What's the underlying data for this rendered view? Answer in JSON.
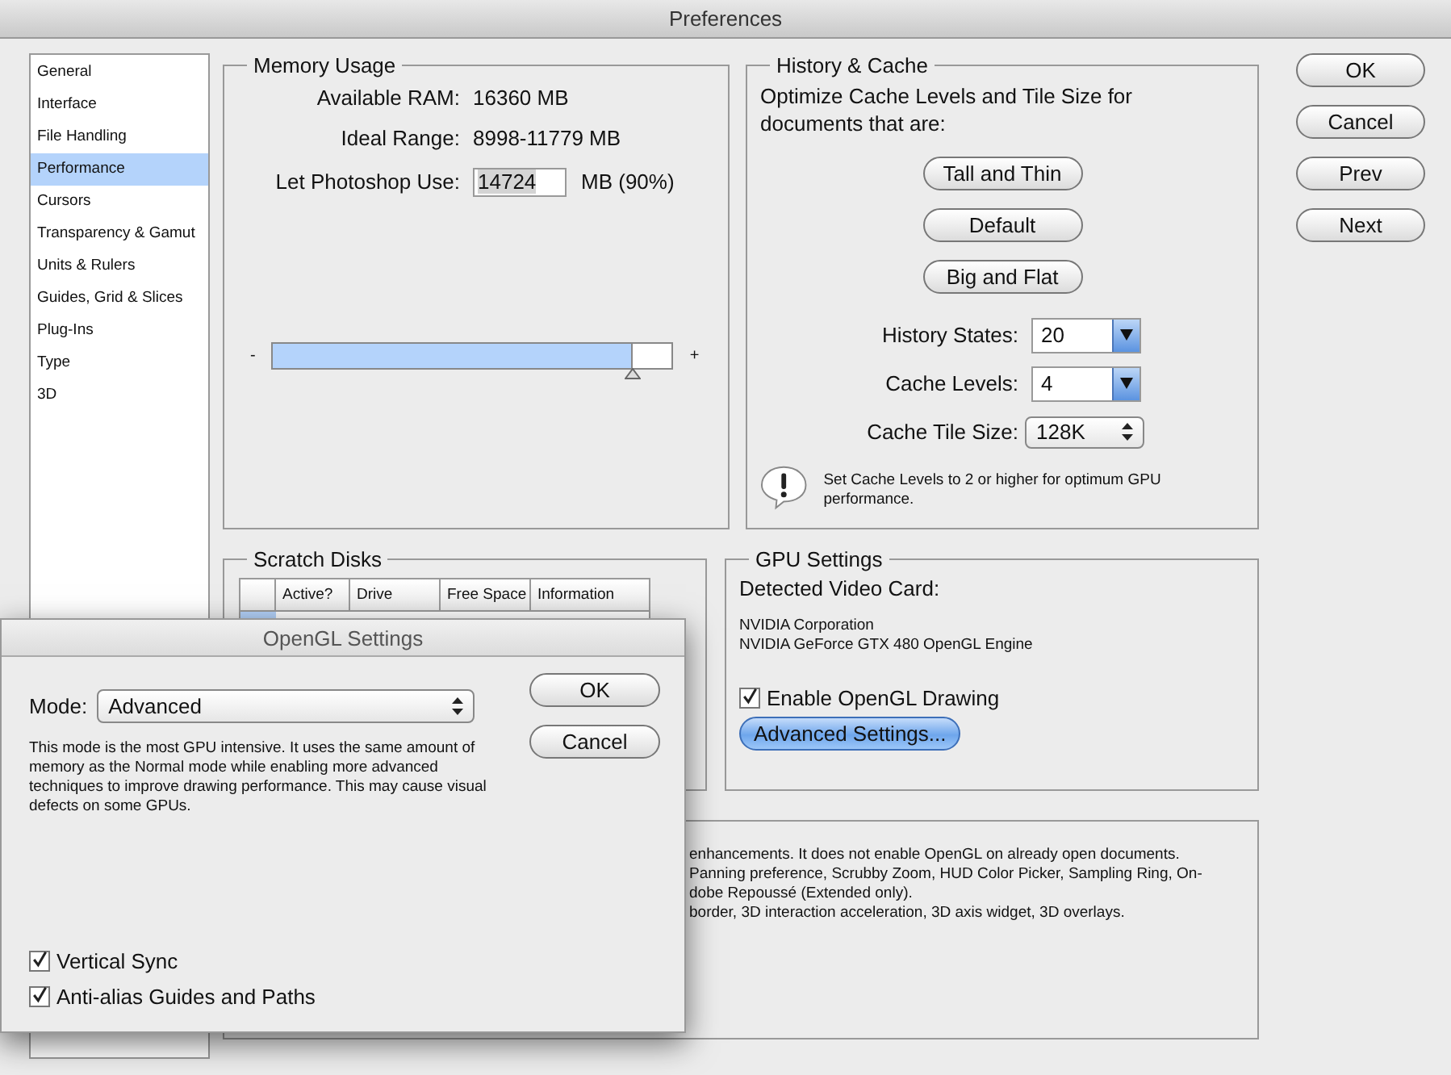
{
  "window": {
    "title": "Preferences"
  },
  "sidebar": {
    "items": [
      {
        "label": "General",
        "selected": false
      },
      {
        "label": "Interface",
        "selected": false
      },
      {
        "label": "File Handling",
        "selected": false
      },
      {
        "label": "Performance",
        "selected": true
      },
      {
        "label": "Cursors",
        "selected": false
      },
      {
        "label": "Transparency & Gamut",
        "selected": false
      },
      {
        "label": "Units & Rulers",
        "selected": false
      },
      {
        "label": "Guides, Grid & Slices",
        "selected": false
      },
      {
        "label": "Plug-Ins",
        "selected": false
      },
      {
        "label": "Type",
        "selected": false
      },
      {
        "label": "3D",
        "selected": false
      }
    ]
  },
  "memory_usage": {
    "title": "Memory Usage",
    "rows": [
      {
        "label": "Available RAM:",
        "value": "16360 MB"
      },
      {
        "label": "Ideal Range:",
        "value": "8998-11779 MB"
      }
    ],
    "use_label": "Let Photoshop Use:",
    "use_value": "14724",
    "use_unit": "MB (90%)",
    "slider": {
      "minus": "-",
      "plus": "+",
      "level": 0.9
    }
  },
  "history_cache": {
    "title": "History & Cache",
    "intro": "Optimize Cache Levels and Tile Size for documents that are:",
    "presets": [
      "Tall and Thin",
      "Default",
      "Big and Flat"
    ],
    "fields": [
      {
        "label": "History States:",
        "value": "20",
        "kind": "combo"
      },
      {
        "label": "Cache Levels:",
        "value": "4",
        "kind": "combo"
      },
      {
        "label": "Cache Tile Size:",
        "value": "128K",
        "kind": "popup"
      }
    ],
    "notice": "Set Cache Levels to 2 or higher for optimum GPU performance."
  },
  "buttons": [
    "OK",
    "Cancel",
    "Prev",
    "Next"
  ],
  "scratch_disks": {
    "title": "Scratch Disks",
    "columns": [
      "Active?",
      "Drive",
      "Free Space",
      "Information"
    ]
  },
  "gpu_settings": {
    "title": "GPU Settings",
    "detected_label": "Detected Video Card:",
    "card_lines": [
      "NVIDIA Corporation",
      "NVIDIA GeForce GTX 480 OpenGL Engine"
    ],
    "enable": {
      "label": "Enable OpenGL Drawing",
      "checked": true
    },
    "advanced_button": "Advanced Settings..."
  },
  "description": {
    "lines": [
      "enhancements. It does not enable OpenGL on already open documents.",
      "Panning preference, Scrubby Zoom, HUD Color Picker, Sampling Ring, On-",
      "dobe Repoussé (Extended only).",
      "border, 3D interaction acceleration, 3D axis widget, 3D overlays."
    ]
  },
  "opengl_dialog": {
    "title": "OpenGL Settings",
    "mode_label": "Mode:",
    "mode_value": "Advanced",
    "description": "This mode is the most GPU intensive.  It uses the same amount of memory as the Normal mode while enabling more advanced techniques to improve drawing performance.  This may cause visual defects on some GPUs.",
    "options": [
      {
        "label": "Vertical Sync",
        "checked": true
      },
      {
        "label": "Anti-alias Guides and Paths",
        "checked": true
      }
    ],
    "buttons": [
      "OK",
      "Cancel"
    ]
  }
}
